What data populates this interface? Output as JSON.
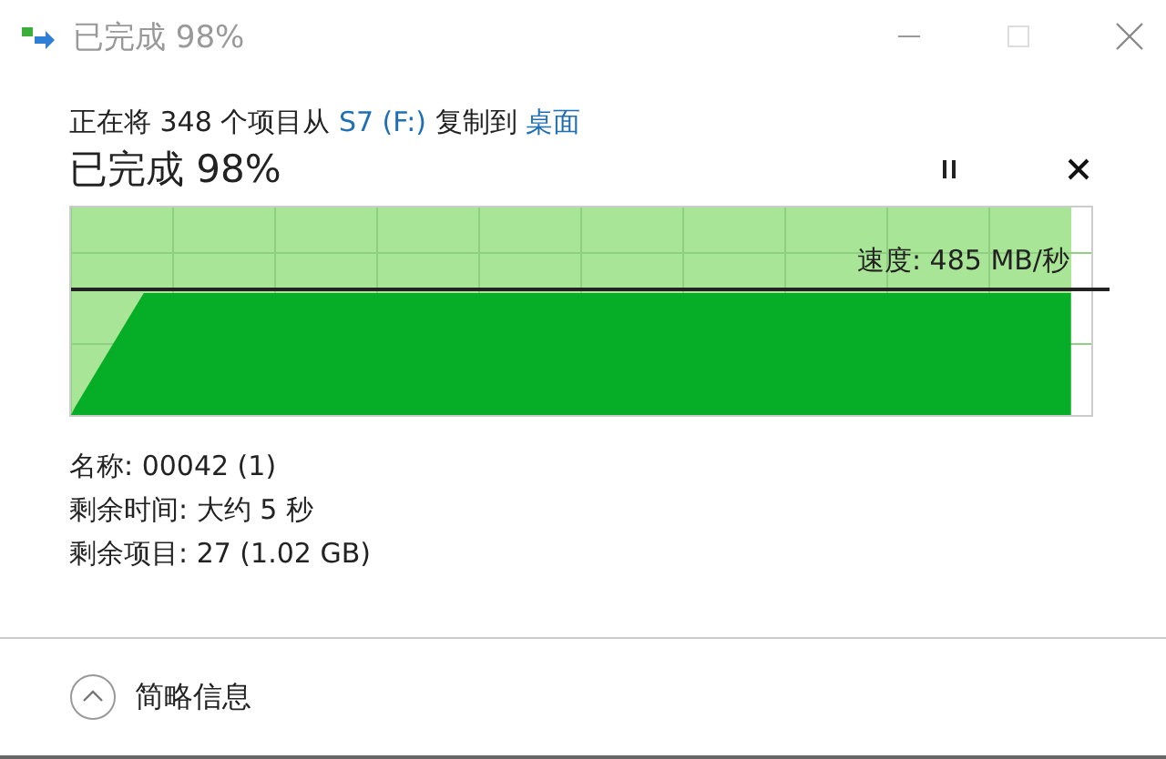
{
  "window": {
    "title": "已完成 98%"
  },
  "description": {
    "prefix": "正在将 348 个项目从 ",
    "source": "S7 (F:)",
    "middle": " 复制到 ",
    "destination": "桌面"
  },
  "heading": "已完成 98%",
  "progress": {
    "level": 0.98,
    "speed": "速度: 485 MB/秒"
  },
  "details": [
    "名称: 00042 (1)",
    "剩余时间: 大约 5 秒",
    "剩余项目: 27 (1.02 GB)"
  ],
  "footer": {
    "label": "简略信息",
    "expanded": true
  }
}
